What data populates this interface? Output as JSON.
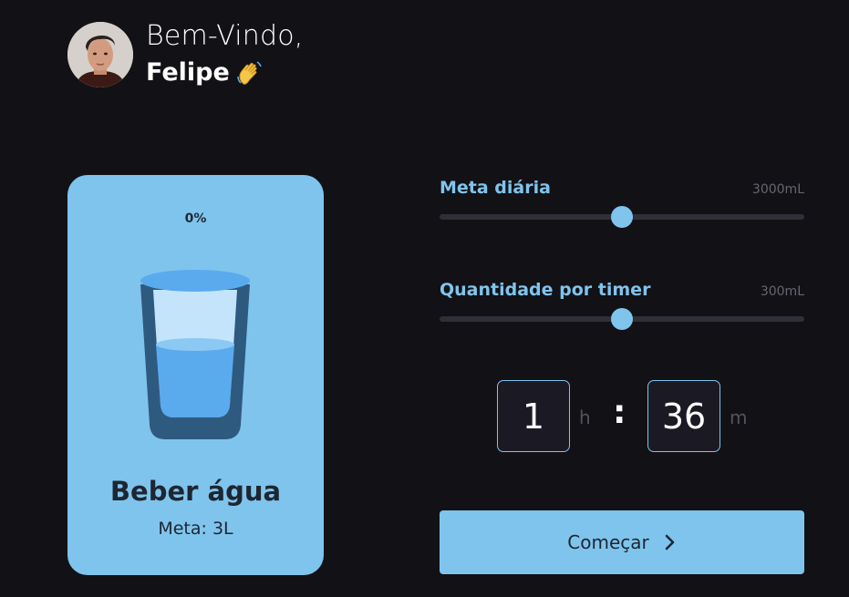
{
  "header": {
    "greeting": "Bem-Vindo,",
    "name": "Felipe",
    "wave_icon": "waving-hand-icon"
  },
  "card": {
    "progress_percent": "0%",
    "progress_fraction": 0,
    "title": "Beber água",
    "goal_text": "Meta: 3L",
    "background": "#7fc4ed"
  },
  "settings": [
    {
      "label": "Meta diária",
      "value": "3000mL",
      "slider_fraction": 0.5
    },
    {
      "label": "Quantidade por timer",
      "value": "300mL",
      "slider_fraction": 0.5
    }
  ],
  "timer": {
    "hours": "1",
    "hours_unit": "h",
    "separator": ":",
    "minutes": "36",
    "minutes_unit": "m"
  },
  "actions": {
    "start_label": "Começar",
    "start_icon": "chevron-right-icon"
  },
  "colors": {
    "background": "#121116",
    "accent": "#7fc4ed",
    "track": "#302f37",
    "muted_text": "#67666f"
  }
}
